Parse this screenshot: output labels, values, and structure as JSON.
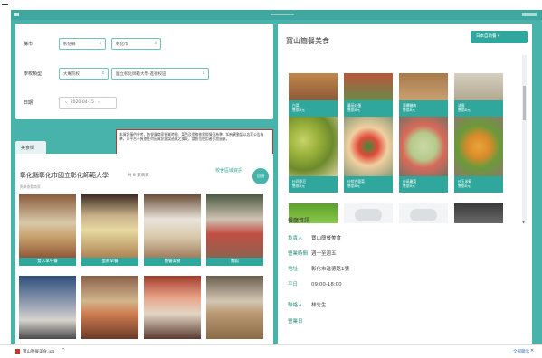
{
  "app": {
    "window_title": ""
  },
  "filter": {
    "row1_label": "縣市",
    "row1_sel1": "彰化縣",
    "row1_sel2": "彰化市",
    "row2_label": "學校類型",
    "row2_sel1": "大專院校",
    "row2_sel2": "國立彰化師範大學-進德校區",
    "row3_label": "日期",
    "date_value": "2020-04-15"
  },
  "notice": {
    "text": "本資訊僅供參考，各餐廳商家營業時間、菜色及價格依實際情況為準，如有異動請以店家公告為準。本平台不負擔任何因資訊錯誤造成之損失，請各位使用者多加留意。"
  },
  "left": {
    "tab_label": "美食街",
    "title": "彰化縣彰化市國立彰化師範大學",
    "subtitle": "共 8 家商家",
    "note": "點擊查看商家",
    "view_all": "校舍區域資訊",
    "fab_label": "回頂",
    "cards": [
      {
        "label": "雙人早午餐"
      },
      {
        "label": "蛋餅早餐"
      },
      {
        "label": "簡餐美食"
      },
      {
        "label": "麵館"
      },
      {
        "label": ""
      },
      {
        "label": ""
      },
      {
        "label": ""
      },
      {
        "label": ""
      }
    ]
  },
  "right": {
    "title": "寶山簡餐美食",
    "button_label": "日本自助餐",
    "dishes_top": [
      {
        "label": "白菜\n售價8元"
      },
      {
        "label": "蕃茄炒蛋\n售價8元"
      },
      {
        "label": "蔥爆豬肉\n售價8元"
      },
      {
        "label": "滷蛋\n售價8元"
      }
    ],
    "dishes_mid": [
      {
        "label": "炒四季豆\n售價8元"
      },
      {
        "label": "炒綜合蔬菜\n售價8元"
      },
      {
        "label": "炒高麗菜\n售價8元"
      },
      {
        "label": "炒玉米筍\n售價8元"
      }
    ],
    "info_heading": "餐廳資訊",
    "info": [
      {
        "k": "負責人",
        "v": "寶山簡餐美食"
      },
      {
        "k": "營業時間",
        "v": "週一至週五"
      },
      {
        "k": "地址",
        "v": "彰化市進德路1號"
      },
      {
        "k": "平日",
        "v": "09:00-18:00"
      },
      {
        "k": "聯絡人",
        "v": "林先生"
      },
      {
        "k": "營業日",
        "v": ""
      }
    ]
  },
  "taskbar": {
    "item_text": "寶山簡餐美食.jpg",
    "right_text": "全部顯示"
  }
}
